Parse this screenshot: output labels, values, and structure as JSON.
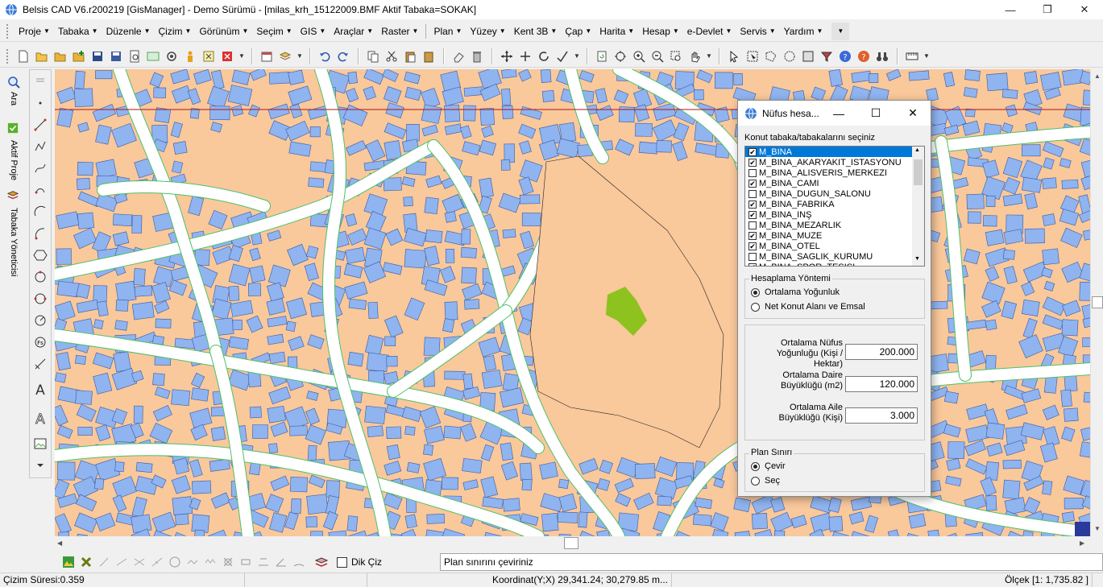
{
  "window": {
    "title": "Belsis CAD V6.r200219 [GisManager] - Demo Sürümü - [milas_krh_15122009.BMF  Aktif Tabaka=SOKAK]"
  },
  "menu": {
    "items": [
      "Proje",
      "Tabaka",
      "Düzenle",
      "Çizim",
      "Görünüm",
      "Seçim",
      "GIS",
      "Araçlar",
      "Raster",
      "Plan",
      "Yüzey",
      "Kent 3B",
      "Çap",
      "Harita",
      "Hesap",
      "e-Devlet",
      "Servis",
      "Yardım"
    ]
  },
  "left_tabs": {
    "ara": "Ara",
    "aktif_proje": "Aktif Proje",
    "tabaka_yoneticisi": "Tabaka Yöneticisi"
  },
  "dialog": {
    "title": "Nüfus hesa...",
    "layer_prompt": "Konut tabaka/tabakalarını seçiniz",
    "layers": [
      {
        "name": "M_BINA",
        "checked": true,
        "selected": true
      },
      {
        "name": "M_BINA_AKARYAKIT_ISTASYONU",
        "checked": true,
        "selected": false
      },
      {
        "name": "M_BINA_ALISVERIS_MERKEZI",
        "checked": false,
        "selected": false
      },
      {
        "name": "M_BINA_CAMI",
        "checked": true,
        "selected": false
      },
      {
        "name": "M_BINA_DUGUN_SALONU",
        "checked": false,
        "selected": false
      },
      {
        "name": "M_BINA_FABRIKA",
        "checked": true,
        "selected": false
      },
      {
        "name": "M_BINA_INŞ",
        "checked": true,
        "selected": false
      },
      {
        "name": "M_BINA_MEZARLIK",
        "checked": false,
        "selected": false
      },
      {
        "name": "M_BINA_MUZE",
        "checked": true,
        "selected": false
      },
      {
        "name": "M_BINA_OTEL",
        "checked": true,
        "selected": false
      },
      {
        "name": "M_BINA_SAGLIK_KURUMU",
        "checked": false,
        "selected": false
      },
      {
        "name": "M_BINA_SPOR_TESISI",
        "checked": true,
        "selected": false
      }
    ],
    "method_group": "Hesaplama Yöntemi",
    "method_options": {
      "ortalama": "Ortalama Yoğunluk",
      "net": "Net Konut Alanı ve Emsal"
    },
    "method_selected": "ortalama",
    "fields": {
      "yogunluk_label": "Ortalama Nüfus Yoğunluğu (Kişi / Hektar)",
      "yogunluk_value": "200.000",
      "daire_label": "Ortalama Daire Büyüklüğü (m2)",
      "daire_value": "120.000",
      "aile_label": "Ortalama Aile Büyüklüğü (Kişi)",
      "aile_value": "3.000"
    },
    "plan_group": "Plan Sınırı",
    "plan_options": {
      "cevir": "Çevir",
      "sec": "Seç"
    },
    "plan_selected": "cevir"
  },
  "command": {
    "dik_ciz": "Dik Çiz",
    "prompt": "Plan sınırını çeviriniz"
  },
  "status": {
    "cizim_suresi": "Çizim Süresi:0.359",
    "koordinat": "Koordinat(Y;X)  29,341.24; 30,279.85 m...",
    "olcek": "Ölçek [1: 1,735.82 ]"
  },
  "colors": {
    "building_blue": "#8fb4f0",
    "parcel_tan": "#f9c89b",
    "road_white": "#ffffff",
    "road_green_line": "#4ec06a",
    "highlight_green": "#8dc21f",
    "selection_blue": "#0078d7"
  }
}
